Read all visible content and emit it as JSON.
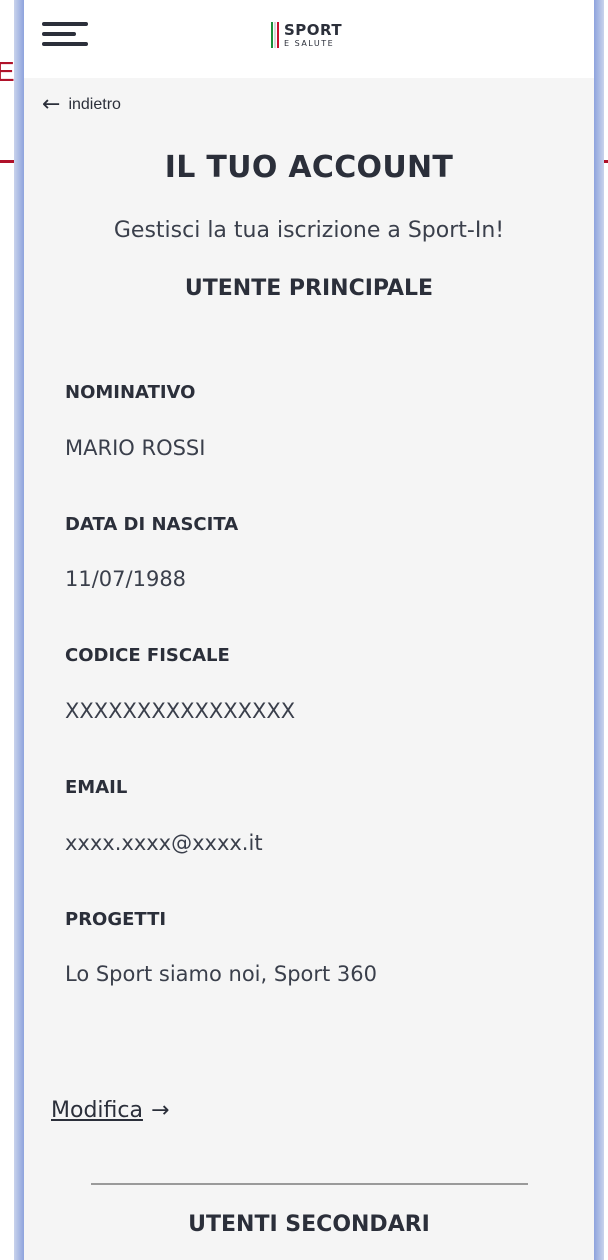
{
  "background": {
    "letter": "E"
  },
  "header": {
    "logo": {
      "line1": "SPORT",
      "line2": "E SALUTE",
      "flag_colors": [
        "#1c8f3a",
        "#ffffff",
        "#c8102e"
      ]
    }
  },
  "nav": {
    "back_label": "indietro",
    "back_icon": "arrow-left-icon"
  },
  "page": {
    "title": "IL TUO ACCOUNT",
    "subtitle": "Gestisci la tua iscrizione a Sport-In!",
    "section_title": "UTENTE PRINCIPALE"
  },
  "fields": [
    {
      "label": "NOMINATIVO",
      "value": "MARIO ROSSI"
    },
    {
      "label": "DATA DI NASCITA",
      "value": "11/07/1988"
    },
    {
      "label": "CODICE FISCALE",
      "value": "XXXXXXXXXXXXXXXX"
    },
    {
      "label": "EMAIL",
      "value": "xxxx.xxxx@xxxx.it"
    },
    {
      "label": "PROGETTI",
      "value": "Lo Sport siamo noi, Sport 360"
    }
  ],
  "actions": {
    "edit_label": "Modifica ",
    "edit_icon": "arrow-right-icon"
  },
  "secondary": {
    "title": "UTENTI SECONDARI"
  },
  "colors": {
    "text": "#2b2f3a",
    "background": "#f5f5f5",
    "accent_red": "#b0122a"
  }
}
